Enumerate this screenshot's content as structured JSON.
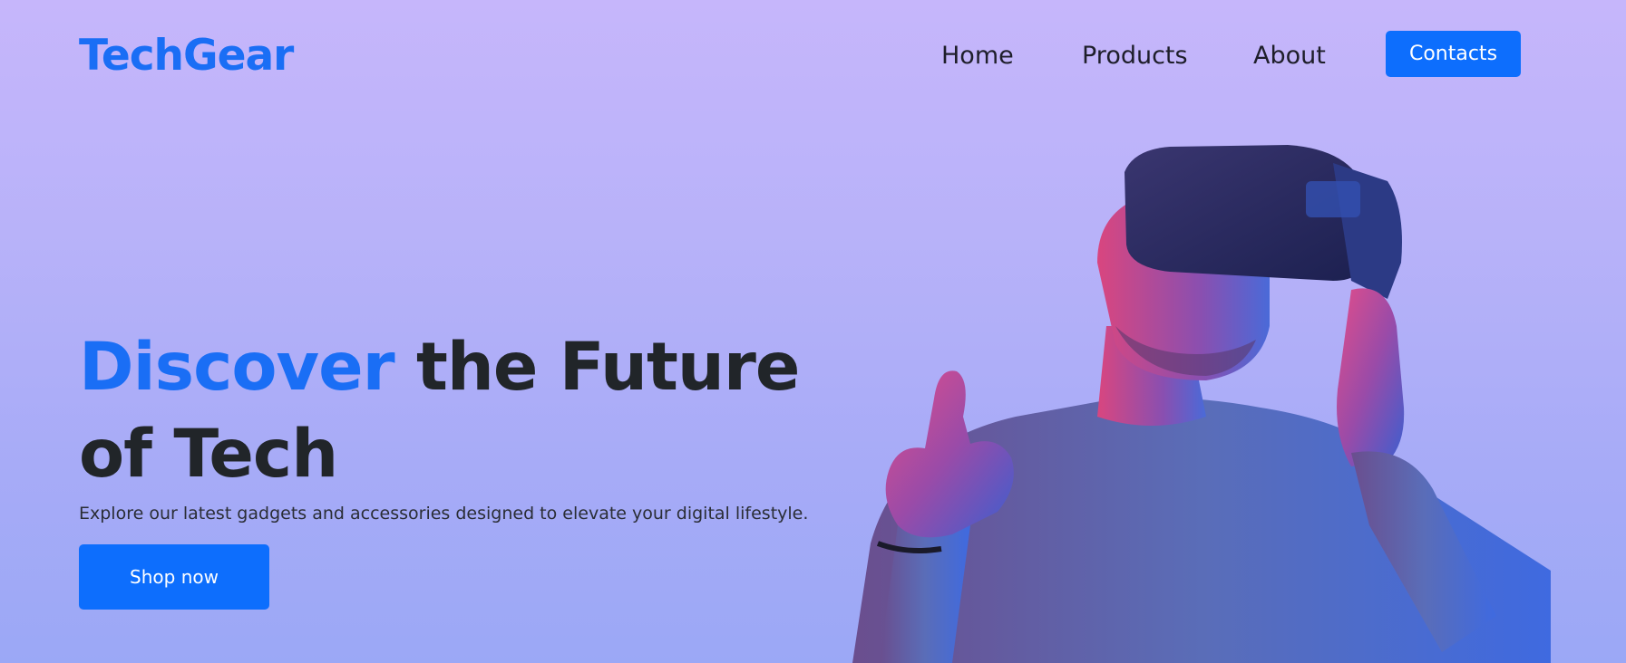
{
  "navbar": {
    "brand": "TechGear",
    "links": [
      "Home",
      "Products",
      "About"
    ],
    "contact_label": "Contacts"
  },
  "hero": {
    "title_accent": "Discover",
    "title_rest": " the Future of Tech",
    "subtitle": "Explore our latest gadgets and accessories designed to elevate your digital lifestyle.",
    "cta_label": "Shop now",
    "image_icon": "vr-headset-person-illustration"
  },
  "colors": {
    "accent": "#1a6ef5",
    "button": "#0d6efd",
    "text": "#212529"
  }
}
